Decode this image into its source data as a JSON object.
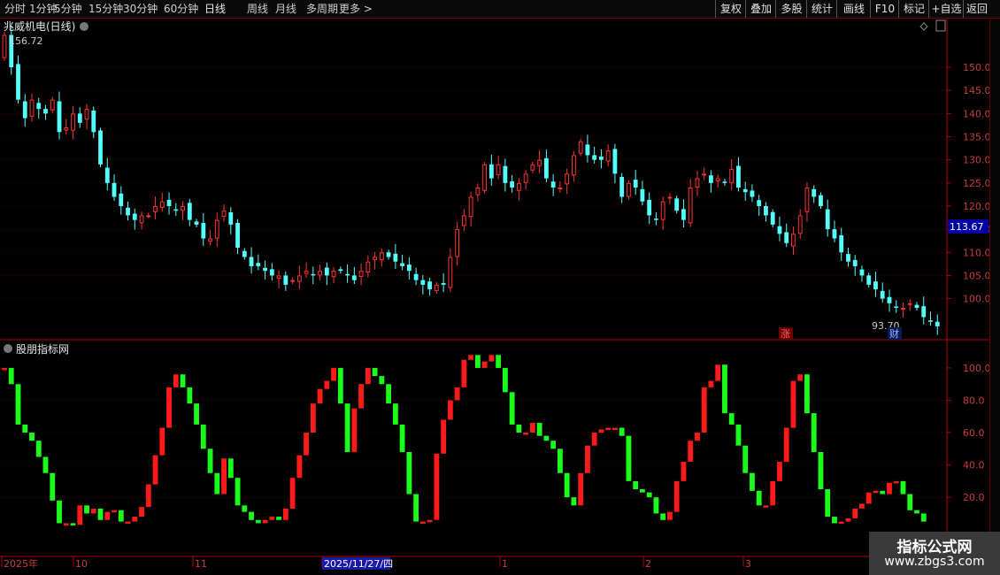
{
  "toolbar": {
    "periods": [
      "分时",
      "1分钟",
      "5分钟",
      "15分钟",
      "30分钟",
      "60分钟",
      "日线",
      "周线",
      "月线",
      "多周期",
      "更多 >"
    ],
    "active_period": "日线",
    "actions": [
      "复权",
      "叠加",
      "多股",
      "统计",
      "画线",
      "F10",
      "标记",
      "+自选",
      "返回"
    ]
  },
  "main_chart": {
    "title": "兆威机电(日线)",
    "high_label": "156.72",
    "low_label": "93.70",
    "current_price": "113.67",
    "marker_zhang": "涨",
    "marker_cai": "财",
    "colors": {
      "up": "#ff3232",
      "down": "#54ffff",
      "grid": "#5a0000",
      "price_box": "#0000a8"
    }
  },
  "indicator": {
    "title": "股朋指标网",
    "colors": {
      "up": "#ff1a1a",
      "down": "#1aff1a"
    }
  },
  "x_axis": {
    "labels": [
      "2025年",
      "10",
      "11",
      "2025/11/27/四",
      "1",
      "2",
      "3"
    ]
  },
  "watermark": {
    "line1": "指标公式网",
    "line2": "www.zbgs3.com"
  },
  "chart_data": [
    {
      "type": "candlestick",
      "title": "兆威机电(日线)",
      "ylim": [
        91.5,
        159
      ],
      "yticks": [
        100.0,
        105.0,
        110.0,
        115.0,
        120.0,
        125.0,
        130.0,
        135.0,
        140.0,
        145.0,
        150.0
      ],
      "closes": [
        157,
        150,
        143,
        139,
        143,
        141,
        140,
        143,
        136,
        137,
        140,
        138,
        141,
        136,
        129,
        125,
        122,
        120,
        118,
        117,
        118,
        118,
        120,
        121,
        120,
        119,
        120,
        117,
        116,
        113,
        113,
        117,
        119,
        116,
        111,
        109,
        107,
        107,
        106,
        105,
        105,
        103,
        104,
        105,
        106,
        105,
        106,
        105,
        106,
        106,
        105,
        104,
        106,
        108,
        109,
        110,
        109,
        108,
        107,
        106,
        104,
        103,
        102,
        103,
        103,
        109,
        115,
        118,
        122,
        124,
        129,
        126,
        129,
        125,
        124,
        125,
        127,
        129,
        130,
        126,
        124,
        124,
        127,
        131,
        134,
        131,
        130,
        130,
        132,
        127,
        122,
        125,
        124,
        121,
        118,
        117,
        121,
        122,
        119,
        117,
        124,
        126,
        127,
        125,
        126,
        125,
        128,
        124,
        123,
        122,
        120,
        118,
        116,
        114,
        112,
        114,
        118,
        124,
        122,
        120,
        115,
        113,
        110,
        108,
        107,
        105,
        103,
        102,
        100,
        99,
        98,
        98,
        99,
        98,
        96,
        95,
        94
      ]
    },
    {
      "type": "bar",
      "title": "股朋指标网",
      "ylim": [
        -10,
        112
      ],
      "yticks": [
        20.0,
        40.0,
        60.0,
        80.0,
        100.0
      ],
      "values": [
        100,
        90,
        65,
        60,
        55,
        45,
        35,
        18,
        4,
        4,
        3,
        15,
        10,
        13,
        6,
        11,
        12,
        5,
        5,
        8,
        14,
        28,
        46,
        63,
        88,
        96,
        88,
        78,
        65,
        50,
        35,
        22,
        44,
        32,
        15,
        11,
        6,
        4,
        6,
        8,
        6,
        13,
        32,
        46,
        60,
        78,
        87,
        92,
        100,
        78,
        48,
        75,
        90,
        100,
        95,
        90,
        78,
        65,
        48,
        22,
        5,
        5,
        6,
        47,
        68,
        80,
        88,
        105,
        108,
        100,
        104,
        108,
        100,
        85,
        65,
        60,
        60,
        66,
        58,
        55,
        50,
        35,
        20,
        15,
        35,
        52,
        60,
        62,
        63,
        63,
        58,
        30,
        25,
        23,
        20,
        10,
        6,
        11,
        30,
        42,
        55,
        60,
        88,
        92,
        102,
        72,
        65,
        52,
        35,
        24,
        15,
        15,
        30,
        42,
        63,
        92,
        96,
        72,
        48,
        25,
        8,
        4,
        5,
        7,
        13,
        16,
        23,
        24,
        22,
        29,
        30,
        22,
        12,
        10,
        5
      ]
    }
  ]
}
